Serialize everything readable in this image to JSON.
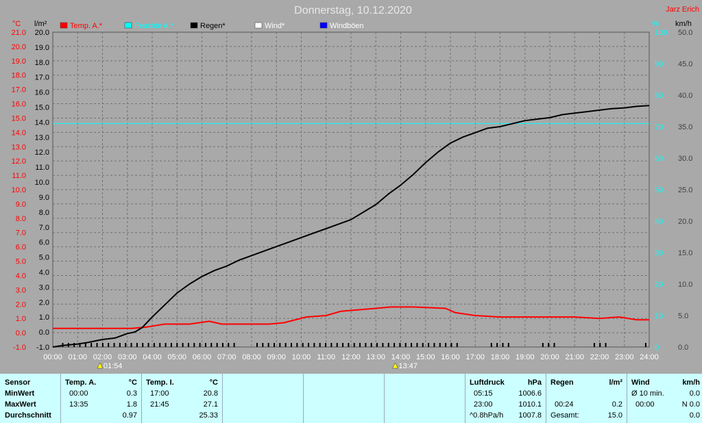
{
  "header": {
    "title": "Donnerstag, 10.12.2020",
    "author": "Jarz Erich"
  },
  "chart_data": {
    "type": "line",
    "title": "Donnerstag, 10.12.2020",
    "xlim": [
      0,
      24
    ],
    "x_ticks": [
      "00:00",
      "01:00",
      "02:00",
      "03:00",
      "04:00",
      "05:00",
      "06:00",
      "07:00",
      "08:00",
      "09:00",
      "10:00",
      "11:00",
      "12:00",
      "13:00",
      "14:00",
      "15:00",
      "16:00",
      "17:00",
      "18:00",
      "19:00",
      "20:00",
      "21:00",
      "22:00",
      "23:00",
      "24:00"
    ],
    "axes": {
      "temp": {
        "unit": "°C",
        "range": [
          -1.0,
          21.0
        ],
        "color": "#ff0000"
      },
      "rain": {
        "unit": "l/m²",
        "range": [
          -1.0,
          20.0
        ],
        "color": "#000000"
      },
      "humidity": {
        "unit": "%",
        "range": [
          0,
          100
        ],
        "color": "#00ffff"
      },
      "wind": {
        "unit": "km/h",
        "range": [
          0.0,
          50.0
        ],
        "color": "#404040"
      }
    },
    "legend": [
      {
        "name": "Temp. A.*",
        "color": "#ff0000"
      },
      {
        "name": "Feuchte A.*",
        "color": "#00ffff"
      },
      {
        "name": "Regen*",
        "color": "#000000"
      },
      {
        "name": "Wind*",
        "color": "#ffffff"
      },
      {
        "name": "Windböen",
        "color": "#0000ff"
      }
    ],
    "series": [
      {
        "name": "Temp. A.*",
        "axis": "temp",
        "color": "#ff0000",
        "x": [
          0,
          1.9,
          3.2,
          3.8,
          4.5,
          5.5,
          6.3,
          6.8,
          7.5,
          8.3,
          8.7,
          9.3,
          10.2,
          11.0,
          11.6,
          12.3,
          13.0,
          13.6,
          14.5,
          15.8,
          16.2,
          17.0,
          18.0,
          19.0,
          20.0,
          21.0,
          22.0,
          22.8,
          23.5,
          24.0
        ],
        "values": [
          0.3,
          0.3,
          0.3,
          0.4,
          0.6,
          0.6,
          0.8,
          0.6,
          0.6,
          0.6,
          0.6,
          0.7,
          1.1,
          1.2,
          1.5,
          1.6,
          1.7,
          1.8,
          1.8,
          1.7,
          1.4,
          1.2,
          1.1,
          1.1,
          1.1,
          1.1,
          1.0,
          1.1,
          0.9,
          0.9
        ]
      },
      {
        "name": "Feuchte A.*",
        "axis": "humidity",
        "color": "#00ffff",
        "x": [
          0,
          24
        ],
        "values": [
          71,
          71
        ]
      },
      {
        "name": "Regen*",
        "axis": "rain",
        "color": "#000000",
        "x": [
          0,
          0.4,
          1.0,
          1.4,
          2.0,
          2.5,
          3.0,
          3.3,
          3.6,
          4.0,
          4.5,
          5.0,
          5.5,
          6.0,
          6.5,
          7.0,
          7.5,
          8.0,
          8.5,
          9.0,
          9.5,
          10.0,
          10.5,
          11.0,
          11.5,
          12.0,
          12.5,
          13.0,
          13.5,
          14.0,
          14.5,
          15.0,
          15.5,
          16.0,
          16.5,
          17.0,
          17.5,
          18.0,
          18.5,
          19.0,
          19.5,
          20.0,
          20.5,
          21.0,
          21.5,
          22.0,
          22.5,
          23.0,
          23.5,
          24.0
        ],
        "values": [
          -1.0,
          -0.9,
          -0.8,
          -0.7,
          -0.5,
          -0.4,
          -0.1,
          0.0,
          0.3,
          1.0,
          1.8,
          2.6,
          3.2,
          3.7,
          4.1,
          4.4,
          4.8,
          5.1,
          5.4,
          5.7,
          6.0,
          6.3,
          6.6,
          6.9,
          7.2,
          7.5,
          8.0,
          8.5,
          9.2,
          9.8,
          10.5,
          11.3,
          12.0,
          12.6,
          13.0,
          13.3,
          13.6,
          13.7,
          13.9,
          14.1,
          14.2,
          14.3,
          14.5,
          14.6,
          14.7,
          14.8,
          14.9,
          14.95,
          15.05,
          15.1
        ]
      }
    ],
    "event_markers": [
      {
        "x": 1.9,
        "label": "01:54"
      },
      {
        "x": 13.78,
        "label": "13:47"
      }
    ],
    "grid": true
  },
  "stats": {
    "sensor": {
      "title": "Sensor",
      "rows": [
        "MinWert",
        "MaxWert",
        "Durchschnitt"
      ]
    },
    "temp_a": {
      "title": "Temp. A.",
      "unit": "°C",
      "min_time": "00:00",
      "min_val": "0.3",
      "max_time": "13:35",
      "max_val": "1.8",
      "avg": "0.97"
    },
    "temp_i": {
      "title": "Temp. I.",
      "unit": "°C",
      "min_time": "17:00",
      "min_val": "20.8",
      "max_time": "21:45",
      "max_val": "27.1",
      "avg": "25.33"
    },
    "pressure": {
      "title": "Luftdruck",
      "unit": "hPa",
      "min_time": "05:15",
      "min_val": "1006.6",
      "max_time": "23:00",
      "max_val": "1010.1",
      "trend": "^0.8hPa/h",
      "avg": "1007.8"
    },
    "rain": {
      "title": "Regen",
      "unit": "l/m²",
      "max_time": "00:24",
      "max_val": "0.2",
      "total_label": "Gesamt:",
      "total": "15.0"
    },
    "wind": {
      "title": "Wind",
      "unit": "km/h",
      "avg_label": "Ø 10 min.",
      "avg_val": "0.0",
      "time": "00:00",
      "dir_val": "N 0.0",
      "avg": "0.0"
    }
  }
}
